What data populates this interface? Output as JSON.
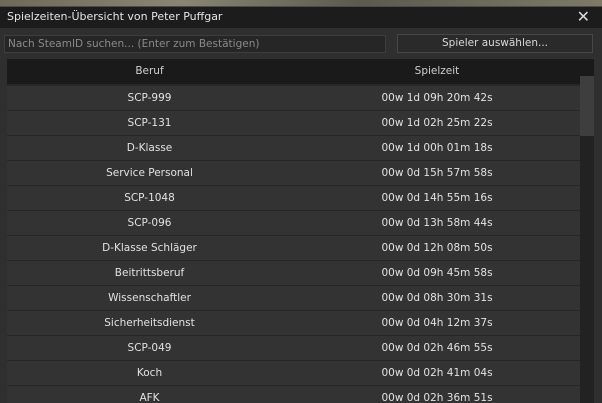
{
  "window": {
    "title": "Spielzeiten-Übersicht von Peter Puffgar",
    "close_glyph": "✕"
  },
  "search": {
    "placeholder": "Nach SteamID suchen... (Enter zum Bestätigen)"
  },
  "select_button": {
    "label": "Spieler auswählen..."
  },
  "table": {
    "columns": [
      "Beruf",
      "Spielzeit"
    ],
    "rows": [
      {
        "beruf": "SCP-999",
        "spielzeit": "00w 1d 09h 20m 42s"
      },
      {
        "beruf": "SCP-131",
        "spielzeit": "00w 1d 02h 25m 22s"
      },
      {
        "beruf": "D-Klasse",
        "spielzeit": "00w 1d 00h 01m 18s"
      },
      {
        "beruf": "Service Personal",
        "spielzeit": "00w 0d 15h 57m 58s"
      },
      {
        "beruf": "SCP-1048",
        "spielzeit": "00w 0d 14h 55m 16s"
      },
      {
        "beruf": "SCP-096",
        "spielzeit": "00w 0d 13h 58m 44s"
      },
      {
        "beruf": "D-Klasse Schläger",
        "spielzeit": "00w 0d 12h 08m 50s"
      },
      {
        "beruf": "Beitrittsberuf",
        "spielzeit": "00w 0d 09h 45m 58s"
      },
      {
        "beruf": "Wissenschaftler",
        "spielzeit": "00w 0d 08h 30m 31s"
      },
      {
        "beruf": "Sicherheitsdienst",
        "spielzeit": "00w 0d 04h 12m 37s"
      },
      {
        "beruf": "SCP-049",
        "spielzeit": "00w 0d 02h 46m 55s"
      },
      {
        "beruf": "Koch",
        "spielzeit": "00w 0d 02h 41m 04s"
      },
      {
        "beruf": "AFK",
        "spielzeit": "00w 0d 02h 36m 51s"
      }
    ]
  },
  "colors": {
    "titlebar": "#1c1c1c",
    "window": "#2f2f2f",
    "row": "#333333",
    "header": "#1a1a1a",
    "text": "#e2e2e2"
  }
}
